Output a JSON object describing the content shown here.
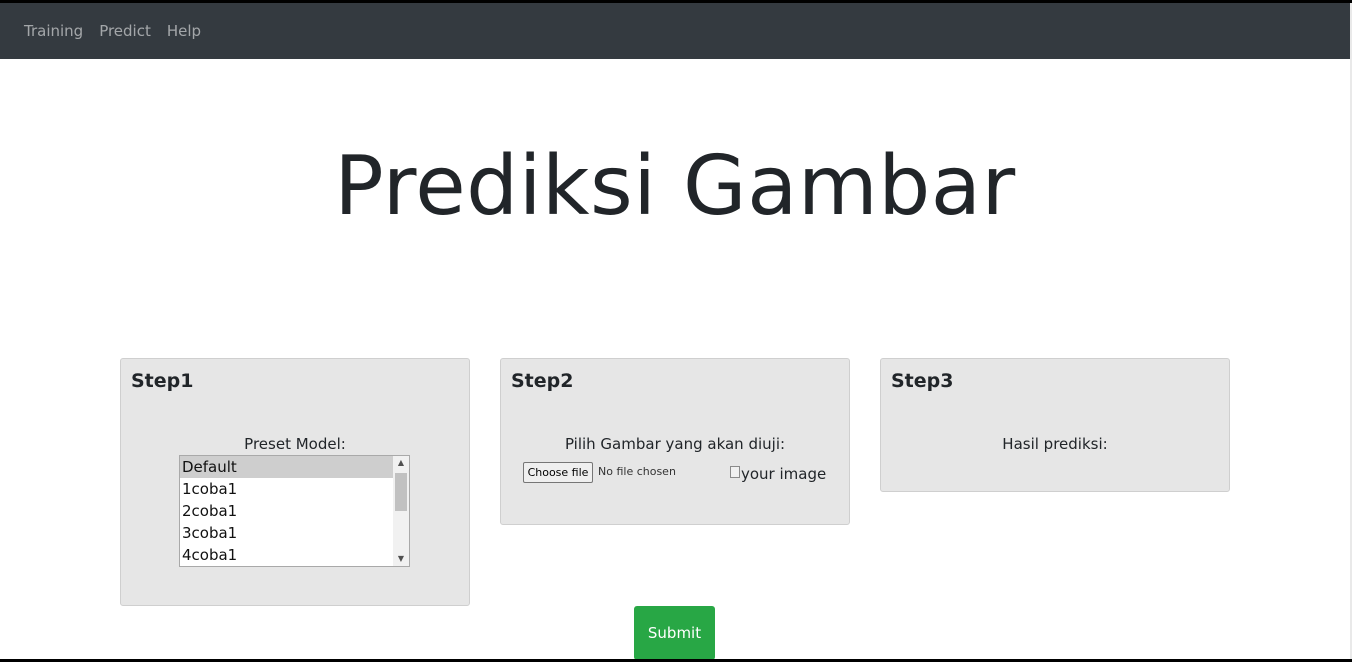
{
  "navbar": {
    "links": [
      "Training",
      "Predict",
      "Help"
    ]
  },
  "page": {
    "title": "Prediksi Gambar"
  },
  "step1": {
    "title": "Step1",
    "label": "Preset Model:",
    "options": [
      "Default",
      "1coba1",
      "2coba1",
      "3coba1",
      "4coba1"
    ],
    "selected": "Default"
  },
  "step2": {
    "title": "Step2",
    "label": "Pilih Gambar yang akan diuji:",
    "file_button": "Choose file",
    "file_status": "No file chosen",
    "image_alt": "your image"
  },
  "step3": {
    "title": "Step3",
    "label": "Hasil prediksi:"
  },
  "submit": {
    "label": "Submit"
  },
  "colors": {
    "navbar_bg": "#343a40",
    "card_bg": "#e6e6e6",
    "submit_bg": "#28a745"
  }
}
